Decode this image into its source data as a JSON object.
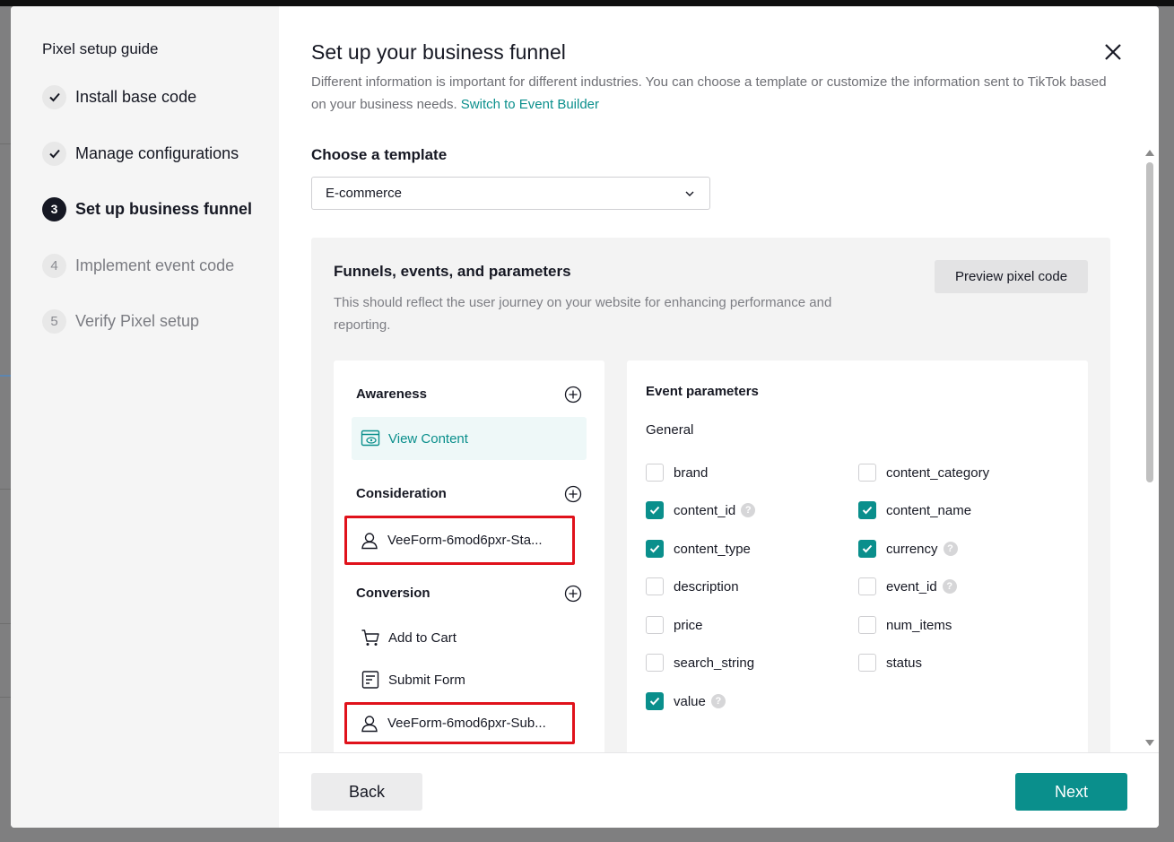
{
  "guide": {
    "title": "Pixel setup guide",
    "steps": [
      {
        "num": "✓",
        "label": "Install base code",
        "state": "done"
      },
      {
        "num": "✓",
        "label": "Manage configurations",
        "state": "done"
      },
      {
        "num": "3",
        "label": "Set up business funnel",
        "state": "current"
      },
      {
        "num": "4",
        "label": "Implement event code",
        "state": "todo"
      },
      {
        "num": "5",
        "label": "Verify Pixel setup",
        "state": "todo"
      }
    ]
  },
  "header": {
    "title": "Set up your business funnel",
    "description": "Different information is important for different industries. You can choose a template or customize the information sent to TikTok based on your business needs.",
    "link": "Switch to Event Builder"
  },
  "template": {
    "label": "Choose a template",
    "selected": "E-commerce"
  },
  "panel": {
    "title": "Funnels, events, and parameters",
    "description": "This should reflect the user journey on your website for enhancing performance and reporting.",
    "preview_button": "Preview pixel code"
  },
  "funnel": {
    "awareness": {
      "title": "Awareness",
      "items": [
        "View Content"
      ]
    },
    "consideration": {
      "title": "Consideration",
      "items": [
        "VeeForm-6mod6pxr-Sta..."
      ]
    },
    "conversion": {
      "title": "Conversion",
      "items": [
        "Add to Cart",
        "Submit Form",
        "VeeForm-6mod6pxr-Sub..."
      ]
    }
  },
  "params": {
    "title": "Event parameters",
    "group": "General",
    "items": [
      {
        "name": "brand",
        "checked": false,
        "help": false
      },
      {
        "name": "content_category",
        "checked": false,
        "help": false
      },
      {
        "name": "content_id",
        "checked": true,
        "help": true
      },
      {
        "name": "content_name",
        "checked": true,
        "help": false
      },
      {
        "name": "content_type",
        "checked": true,
        "help": false
      },
      {
        "name": "currency",
        "checked": true,
        "help": true
      },
      {
        "name": "description",
        "checked": false,
        "help": false
      },
      {
        "name": "event_id",
        "checked": false,
        "help": true
      },
      {
        "name": "price",
        "checked": false,
        "help": false
      },
      {
        "name": "num_items",
        "checked": false,
        "help": false
      },
      {
        "name": "search_string",
        "checked": false,
        "help": false
      },
      {
        "name": "status",
        "checked": false,
        "help": false
      },
      {
        "name": "value",
        "checked": true,
        "help": true
      }
    ]
  },
  "footer": {
    "back": "Back",
    "next": "Next"
  },
  "colors": {
    "accent": "#0a8f8c",
    "highlight": "#e0121b"
  }
}
